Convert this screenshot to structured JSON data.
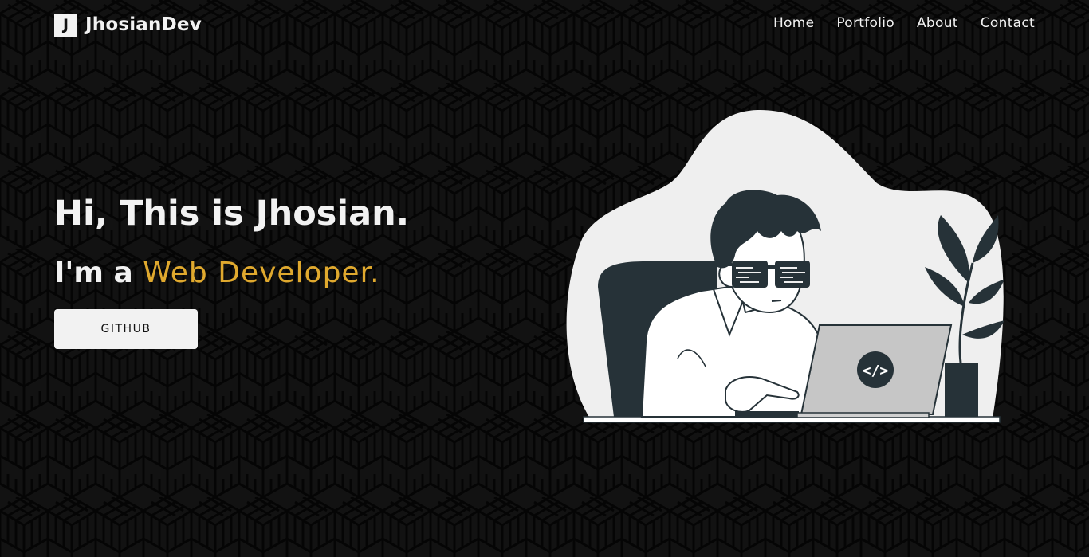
{
  "brand": {
    "logo_letter": "J",
    "name": "JhosianDev"
  },
  "nav": {
    "items": [
      {
        "label": "Home"
      },
      {
        "label": "Portfolio"
      },
      {
        "label": "About"
      },
      {
        "label": "Contact"
      }
    ]
  },
  "hero": {
    "greeting": "Hi, This is Jhosian.",
    "role_prefix": "I'm a ",
    "role_typed": "Web Developer.",
    "button_label": "GITHUB"
  },
  "illustration": {
    "code_icon_text": "</>"
  },
  "colors": {
    "background": "#121212",
    "text": "#f2f2f2",
    "accent": "#e0a92e",
    "illustration_dark": "#263238"
  }
}
